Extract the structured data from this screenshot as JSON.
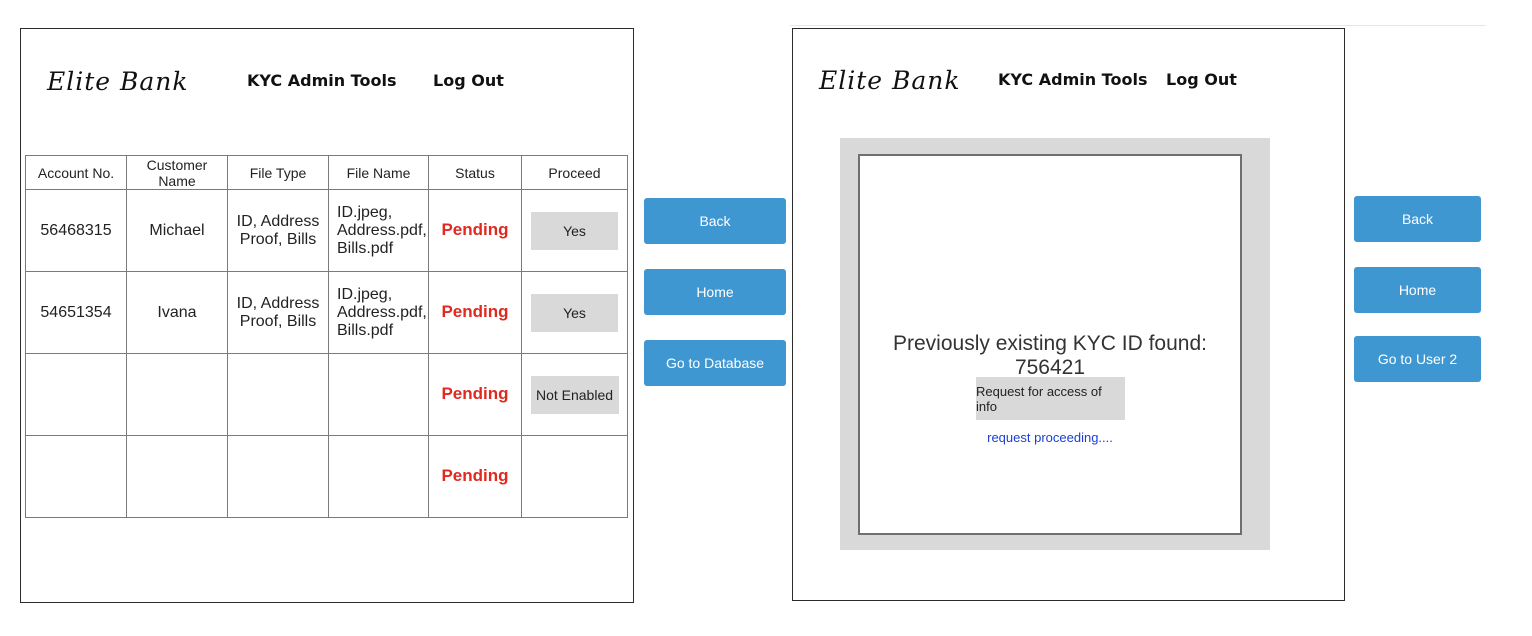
{
  "left_panel": {
    "brand": "Elite Bank",
    "nav_admin": "KYC Admin Tools",
    "nav_logout": "Log Out",
    "table": {
      "headers": [
        "Account No.",
        "Customer Name",
        "File Type",
        "File Name",
        "Status",
        "Proceed"
      ],
      "rows": [
        {
          "account": "56468315",
          "customer": "Michael",
          "file_type_1": "ID, Address",
          "file_type_2": "Proof, Bills",
          "file_name_1": "ID.jpeg,",
          "file_name_2": "Address.pdf,",
          "file_name_3": "Bills.pdf",
          "status": "Pending",
          "proceed": "Yes"
        },
        {
          "account": "54651354",
          "customer": "Ivana",
          "file_type_1": "ID, Address",
          "file_type_2": "Proof, Bills",
          "file_name_1": "ID.jpeg,",
          "file_name_2": "Address.pdf,",
          "file_name_3": "Bills.pdf",
          "status": "Pending",
          "proceed": "Yes"
        },
        {
          "account": "",
          "customer": "",
          "status": "Pending",
          "proceed": "Not Enabled"
        },
        {
          "account": "",
          "customer": "",
          "status": "Pending",
          "proceed": ""
        }
      ]
    },
    "buttons": {
      "back": "Back",
      "home": "Home",
      "database": "Go to Database"
    }
  },
  "right_panel": {
    "brand": "Elite Bank",
    "nav_admin": "KYC Admin Tools",
    "nav_logout": "Log Out",
    "message": "Previously existing KYC ID found: 756421",
    "request_button": "Request for access of info",
    "request_status": "request proceeding....",
    "buttons": {
      "back": "Back",
      "home": "Home",
      "user2": "Go to User 2"
    }
  },
  "colors": {
    "button_blue": "#3f97d2",
    "status_red": "#e0291f",
    "link_blue": "#1a3fd8",
    "gray": "#d9d9d9"
  }
}
